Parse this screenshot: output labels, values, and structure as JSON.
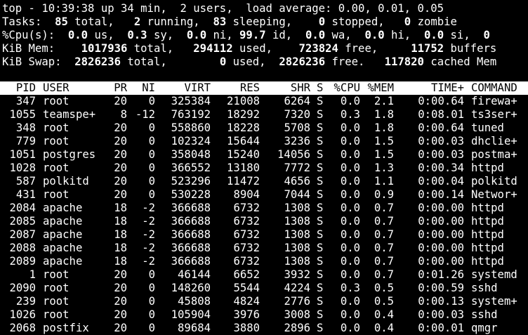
{
  "summary": {
    "line1": "top - 10:39:38 up 34 min,  2 users,  load average: 0.00, 0.01, 0.05",
    "tasks": {
      "label": "Tasks:",
      "total": "85",
      "total_label": "total,",
      "running": "2",
      "running_label": "running,",
      "sleeping": "83",
      "sleeping_label": "sleeping,",
      "stopped": "0",
      "stopped_label": "stopped,",
      "zombie": "0",
      "zombie_label": "zombie"
    },
    "cpu": {
      "label": "%Cpu(s):",
      "us": "0.0",
      "us_label": "us,",
      "sy": "0.3",
      "sy_label": "sy,",
      "ni": "0.0",
      "ni_label": "ni,",
      "id": "99.7",
      "id_label": "id,",
      "wa": "0.0",
      "wa_label": "wa,",
      "hi": "0.0",
      "hi_label": "hi,",
      "si": "0.0",
      "si_label": "si,",
      "st": "0"
    },
    "mem": {
      "label": "KiB Mem:",
      "total": "1017936",
      "total_label": "total,",
      "used": "294112",
      "used_label": "used,",
      "free": "723824",
      "free_label": "free,",
      "buffers": "11752",
      "buffers_label": "buffers"
    },
    "swap": {
      "label": "KiB Swap:",
      "total": "2826236",
      "total_label": "total,",
      "used": "0",
      "used_label": "used,",
      "free": "2826236",
      "free_label": "free.",
      "cached": "117820",
      "cached_label": "cached Mem"
    }
  },
  "columns": {
    "pid": "PID",
    "user": "USER",
    "pr": "PR",
    "ni": "NI",
    "virt": "VIRT",
    "res": "RES",
    "shr": "SHR",
    "s": "S",
    "cpu": "%CPU",
    "mem": "%MEM",
    "time": "TIME+",
    "command": "COMMAND"
  },
  "processes": [
    {
      "pid": "347",
      "user": "root",
      "pr": "20",
      "ni": "0",
      "virt": "325384",
      "res": "21008",
      "shr": "6264",
      "s": "S",
      "cpu": "0.0",
      "mem": "2.1",
      "time": "0:00.64",
      "command": "firewa+"
    },
    {
      "pid": "1055",
      "user": "teamspe+",
      "pr": "8",
      "ni": "-12",
      "virt": "763192",
      "res": "18292",
      "shr": "7320",
      "s": "S",
      "cpu": "0.3",
      "mem": "1.8",
      "time": "0:08.01",
      "command": "ts3ser+"
    },
    {
      "pid": "348",
      "user": "root",
      "pr": "20",
      "ni": "0",
      "virt": "558860",
      "res": "18228",
      "shr": "5708",
      "s": "S",
      "cpu": "0.0",
      "mem": "1.8",
      "time": "0:00.64",
      "command": "tuned"
    },
    {
      "pid": "779",
      "user": "root",
      "pr": "20",
      "ni": "0",
      "virt": "102324",
      "res": "15644",
      "shr": "3236",
      "s": "S",
      "cpu": "0.0",
      "mem": "1.5",
      "time": "0:00.03",
      "command": "dhclie+"
    },
    {
      "pid": "1051",
      "user": "postgres",
      "pr": "20",
      "ni": "0",
      "virt": "358048",
      "res": "15240",
      "shr": "14056",
      "s": "S",
      "cpu": "0.0",
      "mem": "1.5",
      "time": "0:00.03",
      "command": "postma+"
    },
    {
      "pid": "1028",
      "user": "root",
      "pr": "20",
      "ni": "0",
      "virt": "366552",
      "res": "13180",
      "shr": "7772",
      "s": "S",
      "cpu": "0.0",
      "mem": "1.3",
      "time": "0:00.34",
      "command": "httpd"
    },
    {
      "pid": "587",
      "user": "polkitd",
      "pr": "20",
      "ni": "0",
      "virt": "523296",
      "res": "11472",
      "shr": "4656",
      "s": "S",
      "cpu": "0.0",
      "mem": "1.1",
      "time": "0:00.04",
      "command": "polkitd"
    },
    {
      "pid": "431",
      "user": "root",
      "pr": "20",
      "ni": "0",
      "virt": "530228",
      "res": "8904",
      "shr": "7044",
      "s": "S",
      "cpu": "0.0",
      "mem": "0.9",
      "time": "0:00.14",
      "command": "Networ+"
    },
    {
      "pid": "2084",
      "user": "apache",
      "pr": "18",
      "ni": "-2",
      "virt": "366688",
      "res": "6732",
      "shr": "1308",
      "s": "S",
      "cpu": "0.0",
      "mem": "0.7",
      "time": "0:00.00",
      "command": "httpd"
    },
    {
      "pid": "2085",
      "user": "apache",
      "pr": "18",
      "ni": "-2",
      "virt": "366688",
      "res": "6732",
      "shr": "1308",
      "s": "S",
      "cpu": "0.0",
      "mem": "0.7",
      "time": "0:00.00",
      "command": "httpd"
    },
    {
      "pid": "2087",
      "user": "apache",
      "pr": "18",
      "ni": "-2",
      "virt": "366688",
      "res": "6732",
      "shr": "1308",
      "s": "S",
      "cpu": "0.0",
      "mem": "0.7",
      "time": "0:00.00",
      "command": "httpd"
    },
    {
      "pid": "2088",
      "user": "apache",
      "pr": "18",
      "ni": "-2",
      "virt": "366688",
      "res": "6732",
      "shr": "1308",
      "s": "S",
      "cpu": "0.0",
      "mem": "0.7",
      "time": "0:00.00",
      "command": "httpd"
    },
    {
      "pid": "2089",
      "user": "apache",
      "pr": "18",
      "ni": "-2",
      "virt": "366688",
      "res": "6732",
      "shr": "1308",
      "s": "S",
      "cpu": "0.0",
      "mem": "0.7",
      "time": "0:00.00",
      "command": "httpd"
    },
    {
      "pid": "1",
      "user": "root",
      "pr": "20",
      "ni": "0",
      "virt": "46144",
      "res": "6652",
      "shr": "3932",
      "s": "S",
      "cpu": "0.0",
      "mem": "0.7",
      "time": "0:01.26",
      "command": "systemd"
    },
    {
      "pid": "2090",
      "user": "root",
      "pr": "20",
      "ni": "0",
      "virt": "148260",
      "res": "5544",
      "shr": "4224",
      "s": "S",
      "cpu": "0.3",
      "mem": "0.5",
      "time": "0:00.59",
      "command": "sshd"
    },
    {
      "pid": "239",
      "user": "root",
      "pr": "20",
      "ni": "0",
      "virt": "45808",
      "res": "4824",
      "shr": "2776",
      "s": "S",
      "cpu": "0.0",
      "mem": "0.5",
      "time": "0:00.13",
      "command": "system+"
    },
    {
      "pid": "1026",
      "user": "root",
      "pr": "20",
      "ni": "0",
      "virt": "105904",
      "res": "3976",
      "shr": "3008",
      "s": "S",
      "cpu": "0.0",
      "mem": "0.4",
      "time": "0:00.03",
      "command": "sshd"
    },
    {
      "pid": "2068",
      "user": "postfix",
      "pr": "20",
      "ni": "0",
      "virt": "89684",
      "res": "3880",
      "shr": "2896",
      "s": "S",
      "cpu": "0.0",
      "mem": "0.4",
      "time": "0:00.01",
      "command": "qmgr"
    }
  ],
  "colors": {
    "background": "#000000",
    "foreground": "#ffffff",
    "header_bg": "#ffffff",
    "header_fg": "#000000"
  }
}
